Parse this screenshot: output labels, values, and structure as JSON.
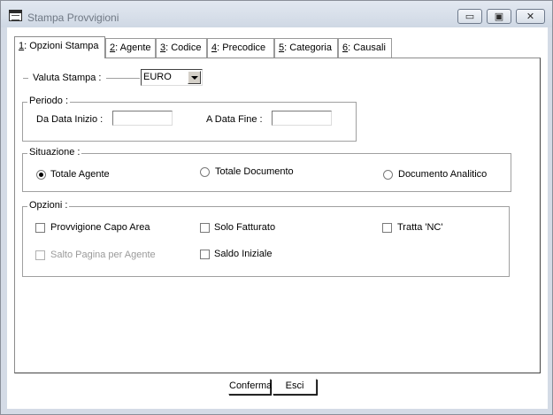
{
  "window": {
    "title": "Stampa Provvigioni",
    "controls": {
      "minimize": "▭",
      "maximize": "▣",
      "close": "✕"
    }
  },
  "tabs": [
    {
      "key": "1",
      "rest": ": Opzioni Stampa",
      "active": true
    },
    {
      "key": "2",
      "rest": ": Agente"
    },
    {
      "key": "3",
      "rest": ": Codice"
    },
    {
      "key": "4",
      "rest": ": Precodice"
    },
    {
      "key": "5",
      "rest": ": Categoria"
    },
    {
      "key": "6",
      "rest": ": Causali"
    }
  ],
  "valuta": {
    "label": "Valuta Stampa :",
    "value": "EURO"
  },
  "periodo": {
    "title": "Periodo :",
    "from_label": "Da Data Inizio :",
    "from_value": "",
    "to_label": "A Data Fine :",
    "to_value": ""
  },
  "situazione": {
    "title": "Situazione :",
    "options": [
      "Totale Agente",
      "Totale Documento",
      "Documento Analitico"
    ],
    "selected": "Totale Agente"
  },
  "opzioni": {
    "title": "Opzioni :",
    "provvigione_capo_area": {
      "label": "Provvigione Capo Area",
      "checked": false
    },
    "solo_fatturato": {
      "label": "Solo Fatturato",
      "checked": false
    },
    "tratta_nc": {
      "label": "Tratta 'NC'",
      "checked": false
    },
    "salto_pagina": {
      "label": "Salto Pagina per Agente",
      "checked": false,
      "enabled": false
    },
    "saldo_iniziale": {
      "label": "Saldo Iniziale",
      "checked": false
    }
  },
  "buttons": {
    "confirm": "Conferma",
    "exit": "Esci"
  }
}
